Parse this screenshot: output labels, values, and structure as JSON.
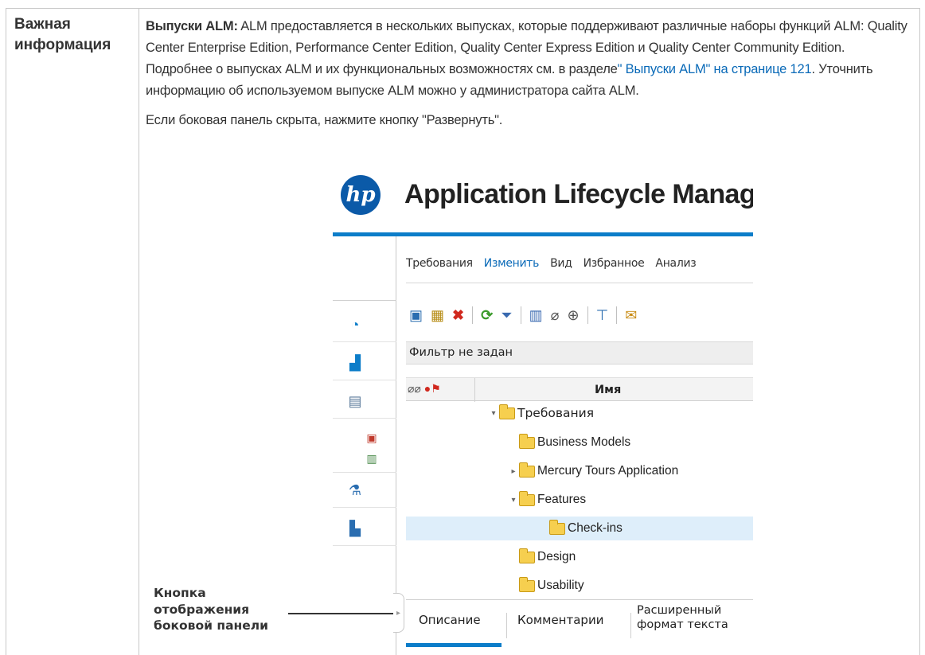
{
  "label": "Важная информация",
  "paragraph1": {
    "lead_bold": "Выпуски ALM:",
    "text1": " ALM предоставляется в нескольких выпусках, которые поддерживают различные наборы функций ALM: Quality Center Enterprise Edition, Performance Center Edition, Quality Center Express Edition и Quality Center Community Edition. Подробнее о выпусках ALM и их функциональных возможностях см. в разделе",
    "link": "\" Выпуски ALM\" на странице 121",
    "text2": ". Уточнить информацию об используемом выпуске ALM можно у администратора сайта ALM."
  },
  "paragraph2": "Если боковая панель скрыта, нажмите кнопку \"Развернуть\".",
  "screenshot": {
    "logo_text": "hp",
    "app_title": "Application Lifecycle Manag",
    "menu": [
      "Требования",
      "Изменить",
      "Вид",
      "Избранное",
      "Анализ"
    ],
    "active_menu": "Изменить",
    "filter_text": "Фильтр не задан",
    "column_header": "Имя",
    "tree": [
      {
        "label": "Требования",
        "expander": "▾"
      },
      {
        "label": "Business Models",
        "expander": ""
      },
      {
        "label": "Mercury Tours Application",
        "expander": "▸"
      },
      {
        "label": "Features",
        "expander": "▾"
      },
      {
        "label": "Check-ins",
        "expander": "",
        "selected": true
      },
      {
        "label": "Design",
        "expander": ""
      },
      {
        "label": "Usability",
        "expander": ""
      }
    ],
    "tabs": [
      "Описание",
      "Комментарии",
      "Расширенный формат текста"
    ],
    "tab_line1": "Расширенный",
    "tab_line2": "формат текста"
  },
  "callout": [
    "Кнопка",
    "отображения",
    "боковой панели"
  ],
  "colors": {
    "accent": "#0c7dc9",
    "link": "#0a6ab8",
    "selection": "#deeefa"
  }
}
